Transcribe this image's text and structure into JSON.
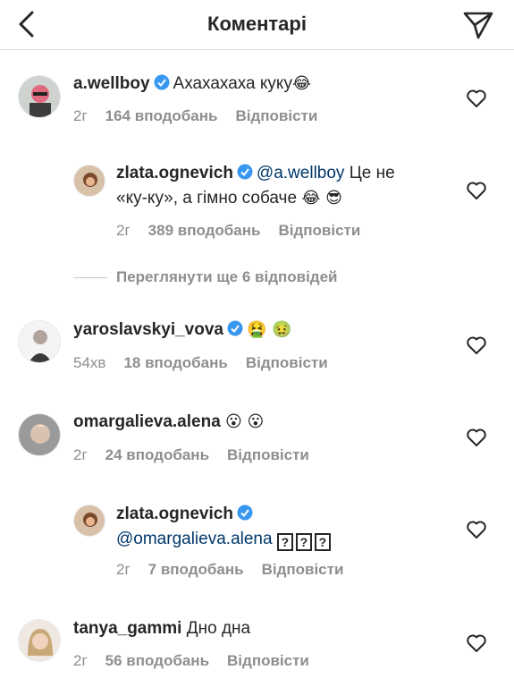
{
  "header": {
    "title": "Коментарі",
    "back_icon": "chevron-left-icon",
    "send_icon": "paper-plane-icon"
  },
  "comments": [
    {
      "username": "a.wellboy",
      "verified": true,
      "mention": "",
      "text": "Ахахахаха куку",
      "emoji": "😂",
      "time": "2г",
      "likes": "164 вподобань",
      "reply": "Відповісти"
    },
    {
      "username": "zlata.ognevich",
      "verified": true,
      "mention": "@a.wellboy",
      "text_line1": "Це не",
      "text_line2": "«ку-ку», а гімно собаче",
      "emoji": "😂 😎",
      "time": "2г",
      "likes": "389 вподобань",
      "reply": "Відповісти"
    },
    {
      "username": "yaroslavskyi_vova",
      "verified": true,
      "emoji": "🤮 🤢",
      "time": "54хв",
      "likes": "18 вподобань",
      "reply": "Відповісти"
    },
    {
      "username": "omargalieva.alena",
      "verified": false,
      "emoji": "😮 😮",
      "time": "2г",
      "likes": "24 вподобань",
      "reply": "Відповісти"
    },
    {
      "username": "zlata.ognevich",
      "verified": true,
      "mention": "@omargalieva.alena",
      "boxes": [
        "?",
        "?",
        "?"
      ],
      "time": "2г",
      "likes": "7 вподобань",
      "reply": "Відповісти"
    },
    {
      "username": "tanya_gammi",
      "verified": false,
      "text": "Дно дна",
      "time": "2г",
      "likes": "56 вподобань",
      "reply": "Відповісти"
    }
  ],
  "view_more": "Переглянути ще 6 відповідей",
  "colors": {
    "text": "#262626",
    "meta": "#8e8e8e",
    "mention": "#00376b",
    "verified": "#3897f0"
  }
}
